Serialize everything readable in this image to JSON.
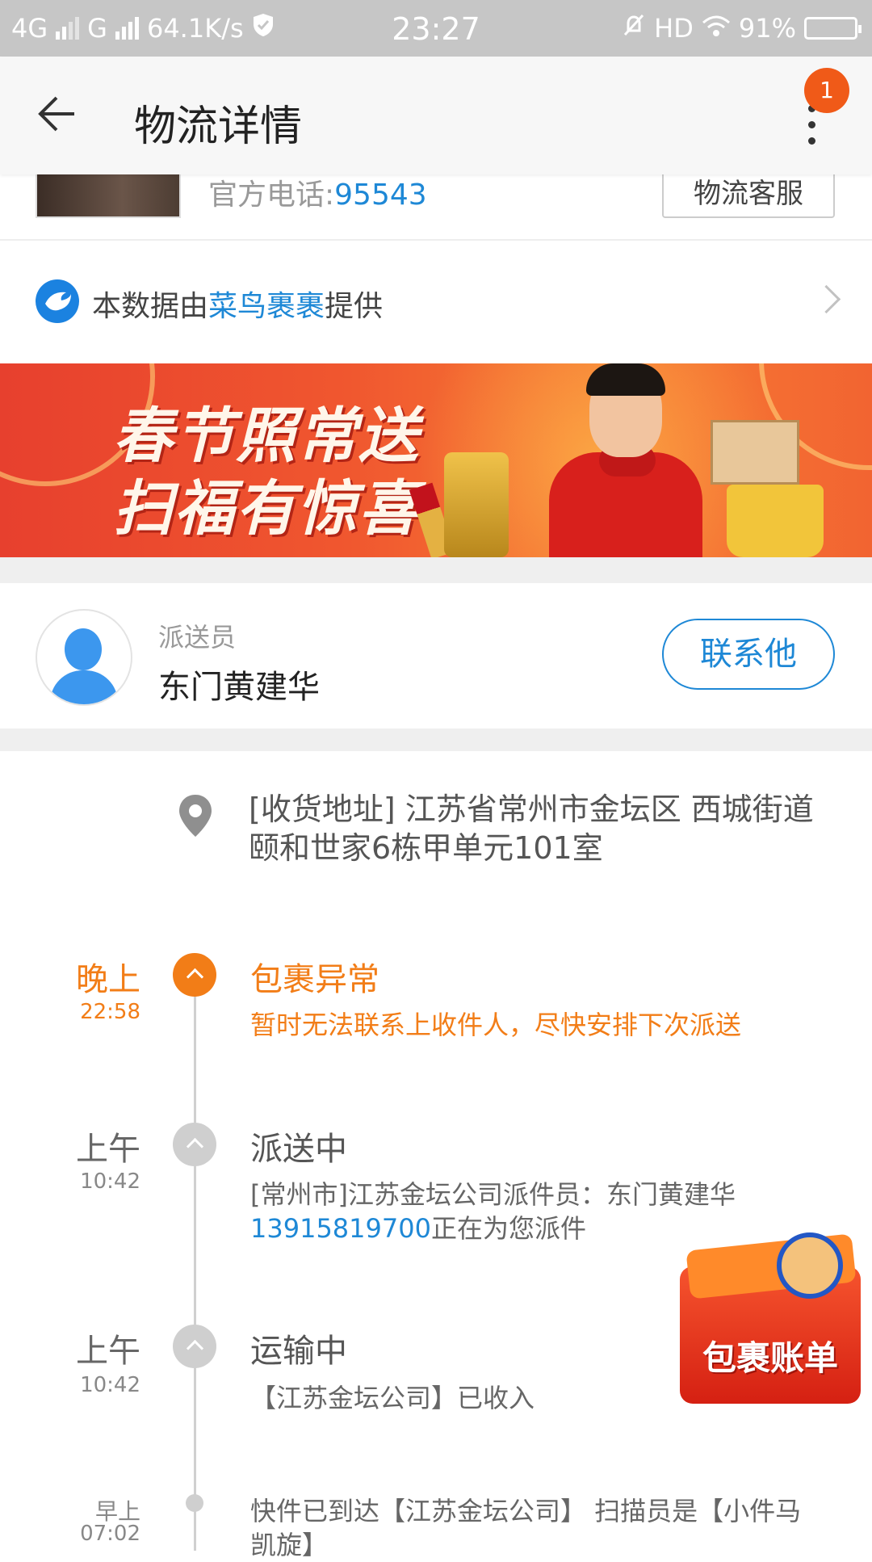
{
  "status_bar": {
    "network1": "4G",
    "network2": "G",
    "speed": "64.1K/s",
    "time": "23:27",
    "hd": "HD",
    "battery": "91%"
  },
  "header": {
    "title": "物流详情",
    "badge_count": "1"
  },
  "company": {
    "phone_label": "官方电话:",
    "phone_number": "95543",
    "service_button": "物流客服"
  },
  "provider": {
    "prefix": "本数据由",
    "name": "菜鸟裹裹",
    "suffix": "提供"
  },
  "banner": {
    "line1": "春节照常送",
    "line2": "扫福有惊喜"
  },
  "courier": {
    "role": "派送员",
    "name": "东门黄建华",
    "contact_button": "联系他"
  },
  "address": {
    "text": "[收货地址] 江苏省常州市金坛区 西城街道　颐和世家6栋甲单元101室"
  },
  "events": [
    {
      "period": "晚上",
      "time": "22:58",
      "title": "包裹异常",
      "desc": "暂时无法联系上收件人，尽快安排下次派送"
    },
    {
      "period": "上午",
      "time": "10:42",
      "title": "派送中",
      "desc_pre": "[常州市]江苏金坛公司派件员：东门黄建华",
      "desc_phone": "13915819700",
      "desc_post": "正在为您派件"
    },
    {
      "period": "上午",
      "time": "10:42",
      "title": "运输中",
      "desc": "【江苏金坛公司】已收入"
    },
    {
      "period": "早上",
      "time": "07:02",
      "desc": "快件已到达【江苏金坛公司】 扫描员是【小件马凯旋】"
    }
  ],
  "floating_widget": {
    "label": "包裹账单"
  },
  "colors": {
    "accent_orange": "#f27d17",
    "link_blue": "#1e88d6",
    "badge": "#f05a18"
  }
}
